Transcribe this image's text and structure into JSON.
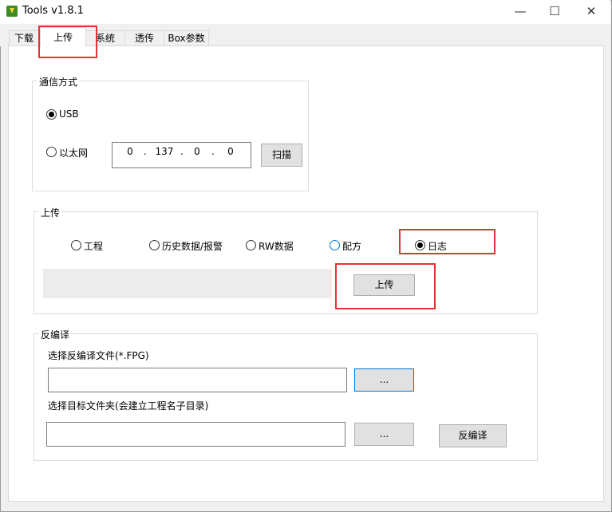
{
  "window": {
    "title": "Tools v1.8.1",
    "icon": "app-icon",
    "min_glyph": "—",
    "max_glyph": "☐",
    "close_glyph": "✕"
  },
  "tabs": [
    {
      "label": "下载"
    },
    {
      "label": "上传"
    },
    {
      "label": "系统"
    },
    {
      "label": "透传"
    },
    {
      "label": "Box参数"
    }
  ],
  "comm": {
    "title": "通信方式",
    "usb_label": "USB",
    "ethernet_label": "以太网",
    "ip": [
      "0",
      "137",
      "0",
      "0"
    ],
    "dot": ".",
    "scan_label": "扫描"
  },
  "upload": {
    "title": "上传",
    "options": [
      {
        "label": "工程"
      },
      {
        "label": "历史数据/报警"
      },
      {
        "label": "RW数据"
      },
      {
        "label": "配方"
      },
      {
        "label": "日志"
      }
    ],
    "button_label": "上传",
    "progress": 0
  },
  "decompile": {
    "title": "反编译",
    "file_label": "选择反编译文件(*.FPG)",
    "file_value": "",
    "browse_label": "...",
    "folder_label": "选择目标文件夹(会建立工程名子目录)",
    "folder_value": "",
    "browse2_label": "...",
    "decompile_label": "反编译"
  }
}
